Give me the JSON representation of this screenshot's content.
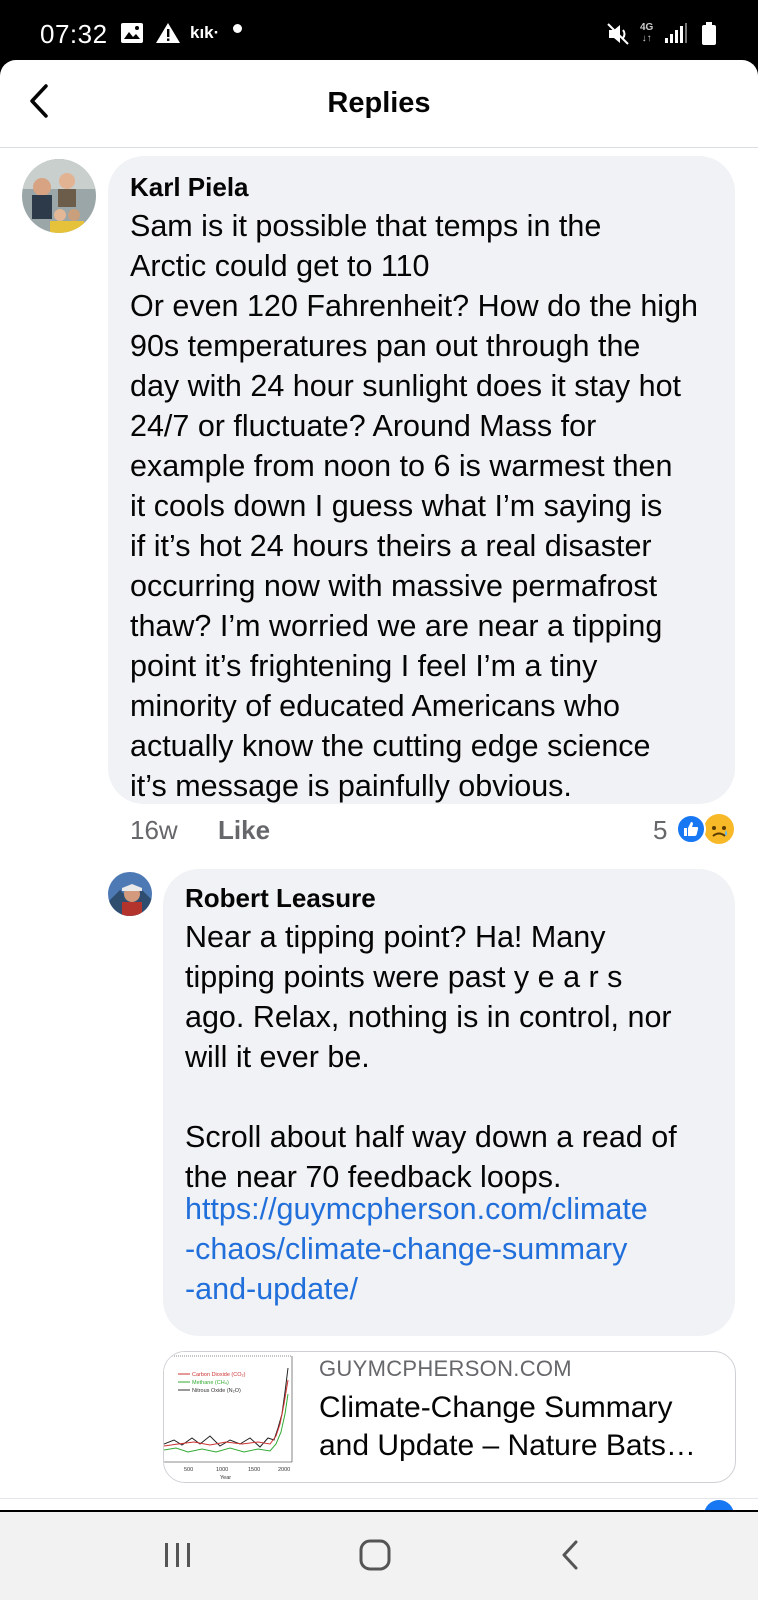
{
  "status_bar": {
    "time": "07:32",
    "kik_label": "kık·",
    "network": "4G",
    "icons": [
      "image-icon",
      "warning-icon",
      "kik-icon",
      "mute-icon",
      "network-4g-icon",
      "signal-icon",
      "battery-icon"
    ]
  },
  "header": {
    "title": "Replies",
    "back_icon": "chevron-left-icon"
  },
  "comment": {
    "author": "Karl Piela",
    "text": "Sam is it possible that temps in the\nArctic could get to 110\nOr even 120 Fahrenheit? How do the high\n90s temperatures pan out through the\nday with 24 hour sunlight does it stay hot\n24/7 or fluctuate? Around Mass for\nexample from noon to 6 is warmest then\nit cools down I guess what I’m saying is\nif it’s hot 24 hours theirs a real disaster\noccurring now with massive permafrost\nthaw? I’m worried we are near a tipping\npoint it’s frightening I feel I’m a tiny\nminority of educated Americans who\nactually know the cutting edge science\nit’s message is painfully obvious.",
    "time": "16w",
    "like_label": "Like",
    "reaction_count": "5",
    "reactions": [
      "like-reaction-icon",
      "sad-reaction-icon"
    ]
  },
  "reply": {
    "author": "Robert Leasure",
    "text": "Near a tipping point? Ha! Many\ntipping points were past y e a r s\nago. Relax, nothing is in control, nor\nwill it ever be.\n\nScroll about half way down a read of\nthe near 70 feedback loops.",
    "link": "https://guymcpherson.com/climate\n-chaos/climate-change-summary\n-and-update/",
    "card": {
      "domain": "GUYMCPHERSON.COM",
      "title": "Climate-Change Summary and Update – Nature Bats…"
    }
  },
  "thumbnail": {
    "legend": [
      "Carbon Dioxide (CO₂)",
      "Methane (CH₄)",
      "Nitrous Oxide (N₂O)"
    ],
    "xticks": [
      "500",
      "1000",
      "1500",
      "2000"
    ],
    "xlabel": "Year"
  },
  "nav_bar": {
    "icons": [
      "recent-apps-icon",
      "home-icon",
      "back-icon"
    ]
  },
  "colors": {
    "link": "#216fdb",
    "bubble": "#f0f2f5",
    "like_blue": "#1877f2",
    "sad_yellow": "#f7b928"
  }
}
